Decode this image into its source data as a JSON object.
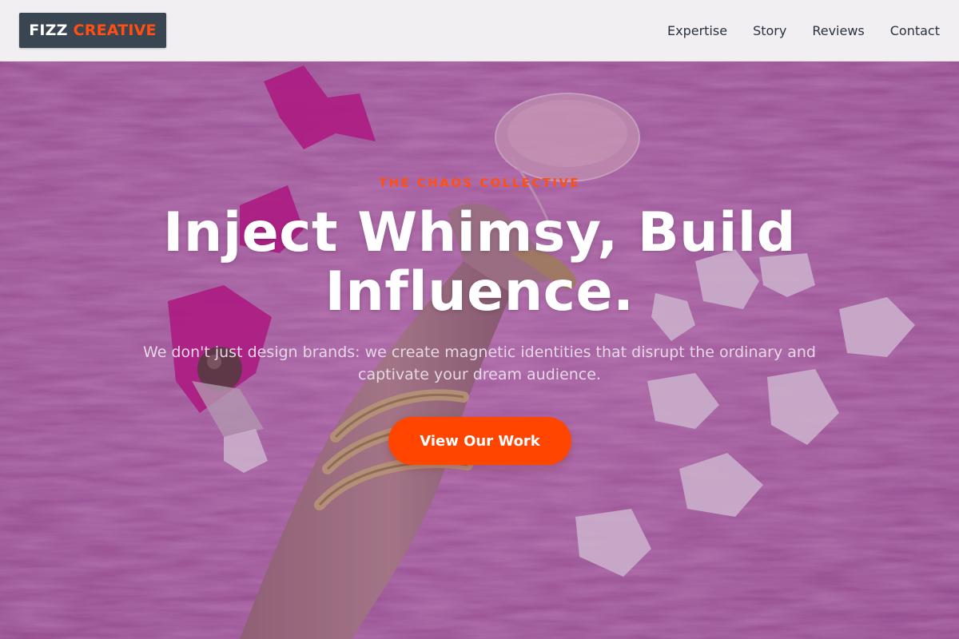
{
  "header": {
    "logo": {
      "word1": "FIZZ",
      "word2": "CREATIVE"
    },
    "nav": [
      {
        "label": "Expertise"
      },
      {
        "label": "Story"
      },
      {
        "label": "Reviews"
      },
      {
        "label": "Contact"
      }
    ]
  },
  "hero": {
    "eyebrow": "THE CHAOS COLLECTIVE",
    "headline_line1": "Inject Whimsy, Build",
    "headline_line2": "Influence.",
    "subtitle": "We don't just design brands: we create magnetic identities that disrupt the ordinary and captivate your dream audience.",
    "cta_label": "View Our Work",
    "background_icon": "photo-pink-fur-candy-petals"
  },
  "colors": {
    "accent": "#ff4500",
    "logo_bg": "#3a4552",
    "header_bg": "#f1eff2",
    "hero_tint": "#a05a9e"
  }
}
